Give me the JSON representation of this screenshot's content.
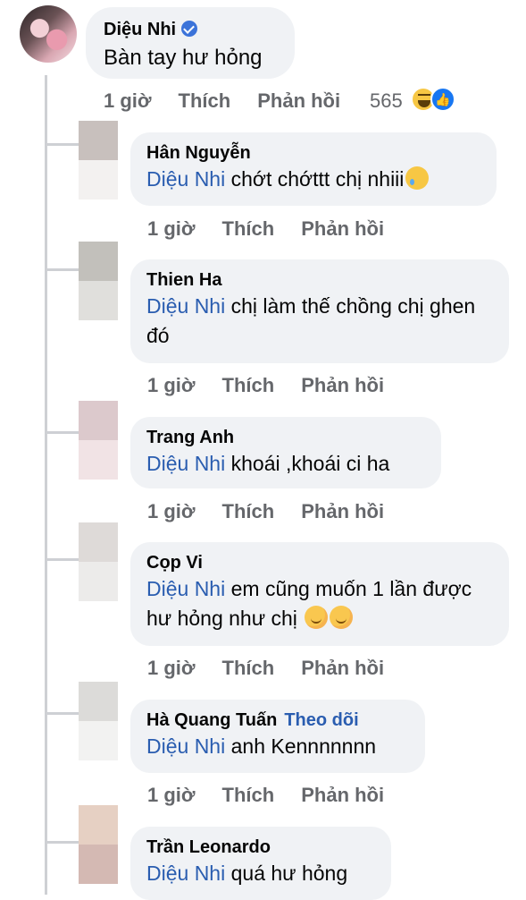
{
  "main_comment": {
    "author": "Diệu Nhi",
    "verified": true,
    "text": "Bàn tay hư hỏng",
    "time": "1 giờ",
    "like_label": "Thích",
    "reply_label": "Phản hồi",
    "reaction_count": "565",
    "reaction_icons": [
      "haha-icon",
      "like-icon"
    ]
  },
  "replies": [
    {
      "author": "Hân Nguyễn",
      "mention": "Diệu Nhi",
      "text": " chớt chớttt chị nhiii",
      "emoji": "sweat-smile-icon",
      "time": "1 giờ",
      "like_label": "Thích",
      "reply_label": "Phản hồi",
      "avatar_colors": [
        "#c8c0bd",
        "#f3f1f0"
      ]
    },
    {
      "author": "Thien Ha",
      "mention": "Diệu Nhi",
      "text": " chị làm thế chồng chị ghen đó",
      "time": "1 giờ",
      "like_label": "Thích",
      "reply_label": "Phản hồi",
      "avatar_colors": [
        "#c2c0bb",
        "#e0dfdc"
      ]
    },
    {
      "author": "Trang Anh",
      "mention": "Diệu Nhi",
      "text": " khoái ,khoái ci ha",
      "time": "1 giờ",
      "like_label": "Thích",
      "reply_label": "Phản hồi",
      "avatar_colors": [
        "#dcc9cc",
        "#f1e3e5"
      ]
    },
    {
      "author": "Cọp Vi",
      "mention": "Diệu Nhi",
      "text": " em cũng muốn 1 lần được hư hỏng như chị ",
      "emoji": "smiling-icon",
      "time": "1 giờ",
      "like_label": "Thích",
      "reply_label": "Phản hồi",
      "avatar_colors": [
        "#dedad8",
        "#ecebea"
      ]
    },
    {
      "author": "Hà Quang Tuấn",
      "follow_label": "Theo dõi",
      "mention": "Diệu Nhi",
      "text": " anh Kennnnnnn",
      "time": "1 giờ",
      "like_label": "Thích",
      "reply_label": "Phản hồi",
      "avatar_colors": [
        "#dcdbd9",
        "#f2f2f1"
      ]
    },
    {
      "author": "Trần Leonardo",
      "mention": "Diệu Nhi",
      "text": " quá hư hỏng",
      "avatar_colors": [
        "#e6d0c3",
        "#d4b9b3"
      ]
    }
  ],
  "colors": {
    "bubble": "#f0f2f5",
    "mention": "#2a5db0",
    "meta": "#65676b",
    "thread_line": "#ced0d4"
  }
}
